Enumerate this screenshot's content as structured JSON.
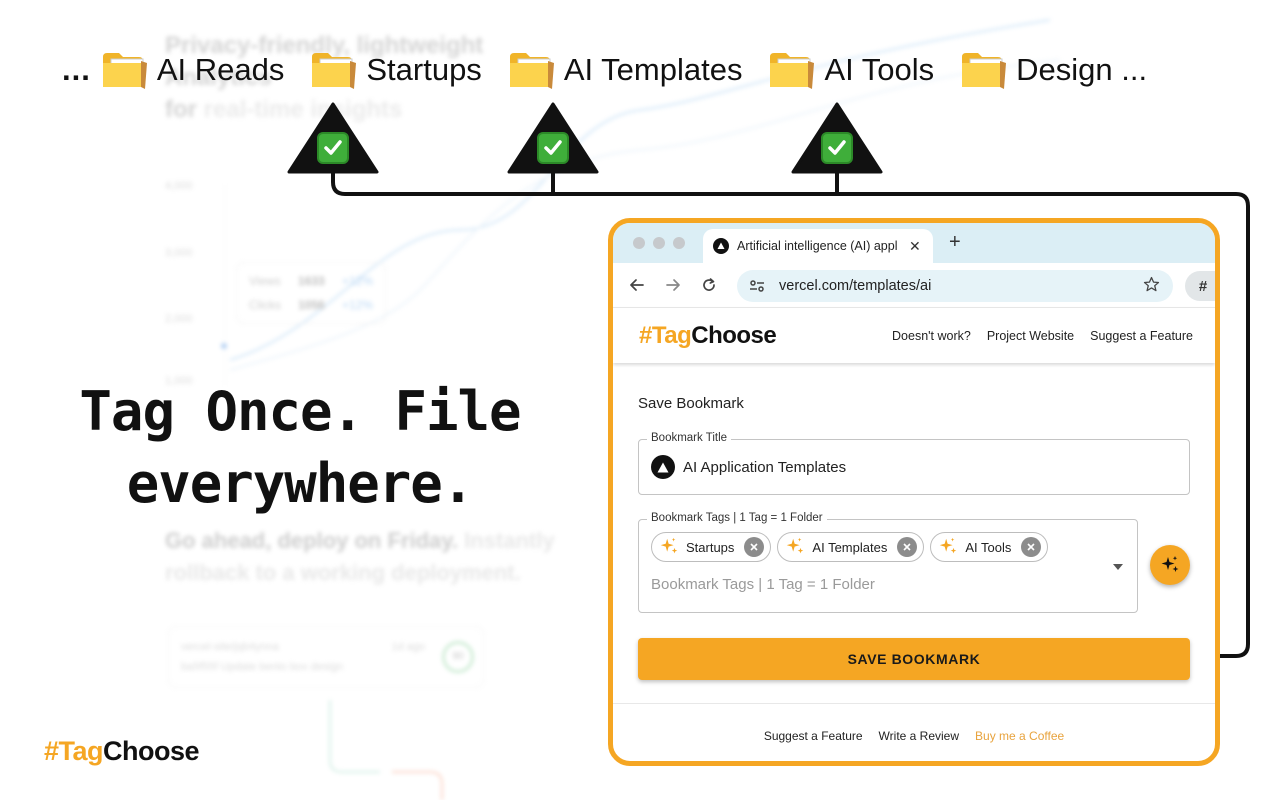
{
  "background": {
    "hero_line1": "Privacy-friendly, lightweight Analytics",
    "hero_line2_a": "for",
    "hero_line2_b": "real-time insights",
    "axis_labels": [
      "4,000",
      "3,000",
      "2,000",
      "1,000"
    ],
    "stats": [
      {
        "label": "Views",
        "value": "1633",
        "delta": "+12%"
      },
      {
        "label": "Clicks",
        "value": "1056",
        "delta": "+12%"
      }
    ],
    "tagline_dark": "Go ahead, deploy on Friday.",
    "tagline_faint": "Instantly rollback to a working deployment.",
    "deploy_card": {
      "repo": "vercel-site/jqb4ynna",
      "age": "1d ago",
      "commit": "ba5f55f  Update bento box design",
      "score": "90"
    }
  },
  "folders": {
    "leading": "...",
    "items": [
      "AI Reads",
      "Startups",
      "AI Templates",
      "AI Tools",
      "Design ..."
    ]
  },
  "headline": {
    "line1": "Tag Once. File",
    "line2": "everywhere."
  },
  "brand": {
    "hash_tag": "#Tag",
    "choose": "Choose"
  },
  "browser": {
    "tab_title": "Artificial intelligence (AI) appl",
    "url": "vercel.com/templates/ai",
    "extension_label": "#"
  },
  "popup": {
    "header_links": [
      "Doesn't work?",
      "Project Website",
      "Suggest a Feature"
    ],
    "section_title": "Save Bookmark",
    "title_field": {
      "label": "Bookmark Title",
      "value": "AI Application Templates"
    },
    "tags_field": {
      "label": "Bookmark Tags | 1 Tag = 1 Folder",
      "placeholder": "Bookmark Tags | 1 Tag = 1 Folder",
      "chips": [
        "Startups",
        "AI Templates",
        "AI Tools"
      ]
    },
    "save_label": "SAVE BOOKMARK",
    "footer_links": {
      "suggest": "Suggest a Feature",
      "review": "Write a Review",
      "coffee": "Buy me a Coffee"
    }
  },
  "colors": {
    "accent": "#f5a623",
    "check_green": "#3fae3a",
    "browser_chrome": "#dbeef5",
    "omnibox": "#e6f3f8"
  }
}
